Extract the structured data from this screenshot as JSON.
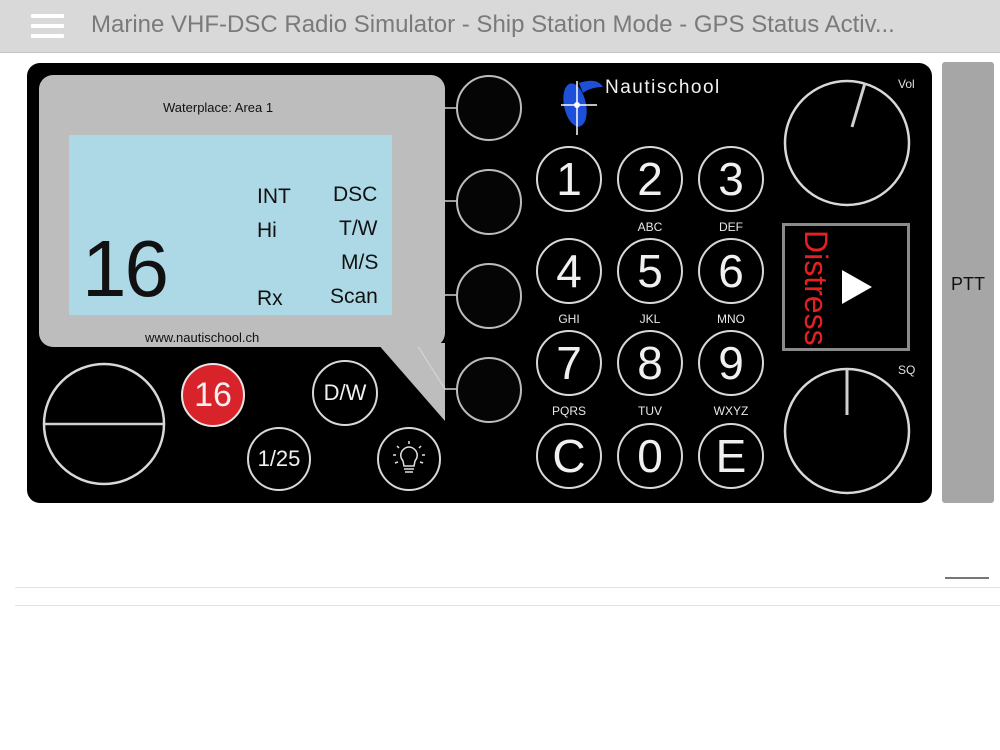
{
  "window": {
    "title": "Marine VHF-DSC Radio Simulator - Ship Station Mode - GPS Status Activ..."
  },
  "display": {
    "waterplace": "Waterplace: Area 1",
    "mode": "INT",
    "power": "Hi",
    "rx": "Rx",
    "channel": "16",
    "website": "www.nautischool.ch",
    "softkey_labels": [
      "DSC",
      "T/W",
      "M/S",
      "Scan"
    ]
  },
  "brand": {
    "name": "Nautischool"
  },
  "keypad": {
    "keys": [
      {
        "digit": "1",
        "letters": ""
      },
      {
        "digit": "2",
        "letters": "ABC"
      },
      {
        "digit": "3",
        "letters": "DEF"
      },
      {
        "digit": "4",
        "letters": "GHI"
      },
      {
        "digit": "5",
        "letters": "JKL"
      },
      {
        "digit": "6",
        "letters": "MNO"
      },
      {
        "digit": "7",
        "letters": "PQRS"
      },
      {
        "digit": "8",
        "letters": "TUV"
      },
      {
        "digit": "9",
        "letters": "WXYZ"
      },
      {
        "digit": "C",
        "letters": ""
      },
      {
        "digit": "0",
        "letters": ""
      },
      {
        "digit": "E",
        "letters": ""
      }
    ]
  },
  "buttons": {
    "ch16": "16",
    "dw": "D/W",
    "ch1_25": "1/25",
    "distress": "Distress",
    "ptt": "PTT"
  },
  "knobs": {
    "volume": {
      "label": "Vol"
    },
    "squelch": {
      "label": "SQ"
    }
  },
  "colors": {
    "lcd_background": "#add8e6",
    "radio_body": "#000000",
    "ch16_button": "#d8232a",
    "distress_text": "#e52020",
    "titlebar": "#d9d9d9"
  }
}
